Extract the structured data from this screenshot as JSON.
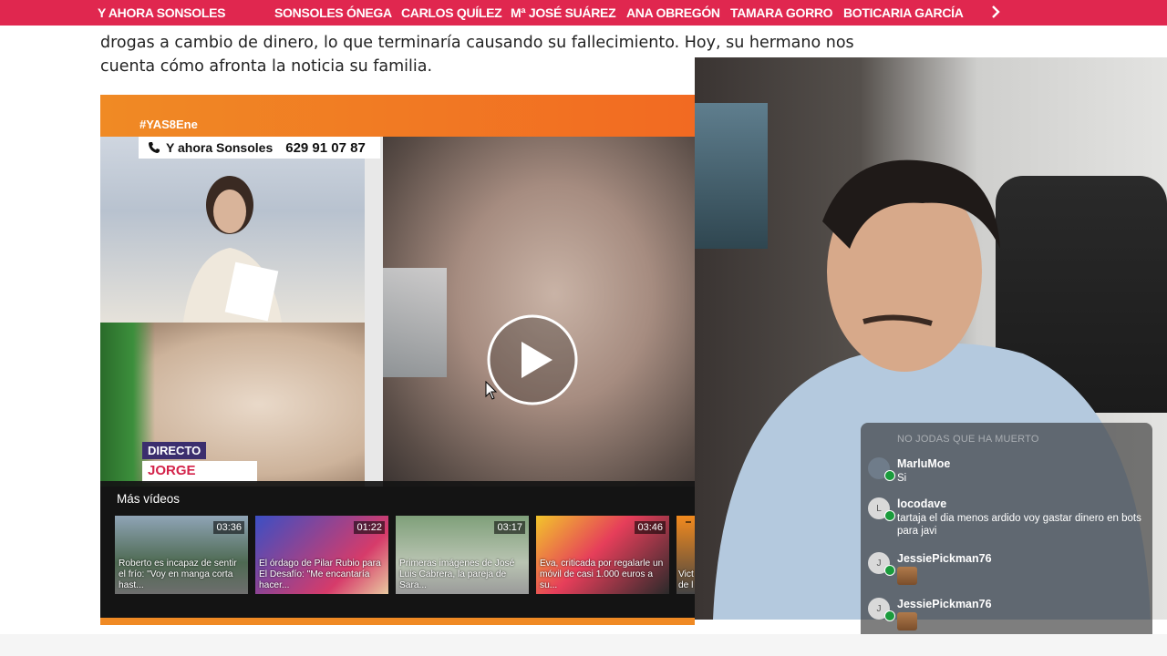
{
  "nav": {
    "items": [
      "Y AHORA SONSOLES",
      "SONSOLES ÓNEGA",
      "CARLOS QUÍLEZ",
      "Mª JOSÉ SUÁREZ",
      "ANA OBREGÓN",
      "TAMARA GORRO",
      "BOTICARIA GARCÍA"
    ]
  },
  "article": {
    "line1": "drogas a cambio de dinero, lo que terminaría causando su fallecimiento. Hoy, su hermano nos",
    "line2": "cuenta cómo afronta la noticia su familia."
  },
  "player": {
    "hashtag": "#YAS8Ene",
    "show_name": "Y ahora Sonsoles",
    "phone": "629 91 07 87",
    "live_label": "DIRECTO",
    "guest_name": "JORGE",
    "more_videos_title": "Más vídeos",
    "videos": [
      {
        "duration": "03:36",
        "caption": "Roberto es incapaz de sentir el frío: \"Voy en manga corta hast..."
      },
      {
        "duration": "01:22",
        "caption": "El órdago de Pilar Rubio para El Desafío: \"Me encantaría hacer..."
      },
      {
        "duration": "03:17",
        "caption": "Primeras imágenes de José Luis Cabrera, la pareja de Sara..."
      },
      {
        "duration": "03:46",
        "caption": "Eva, criticada por regalarle un móvil de casi 1.000 euros a su..."
      },
      {
        "duration": "",
        "caption": "Vict de l"
      }
    ]
  },
  "chat": {
    "ghost_text": "NO JODAS QUE HA MUERTO",
    "messages": [
      {
        "user": "MarluMoe",
        "text": "Si",
        "avatar": ""
      },
      {
        "user": "locodave",
        "text": "tartaja el dia menos ardido voy gastar dinero en bots para javi",
        "avatar": "L"
      },
      {
        "user": "JessiePickman76",
        "text": "",
        "avatar": "J"
      },
      {
        "user": "JessiePickman76",
        "text": "",
        "avatar": "J"
      }
    ]
  },
  "colors": {
    "nav_bg": "#e0274f",
    "accent_orange": "#f08a24",
    "live_tag": "#3b2e6e",
    "name_red": "#d3234a"
  }
}
